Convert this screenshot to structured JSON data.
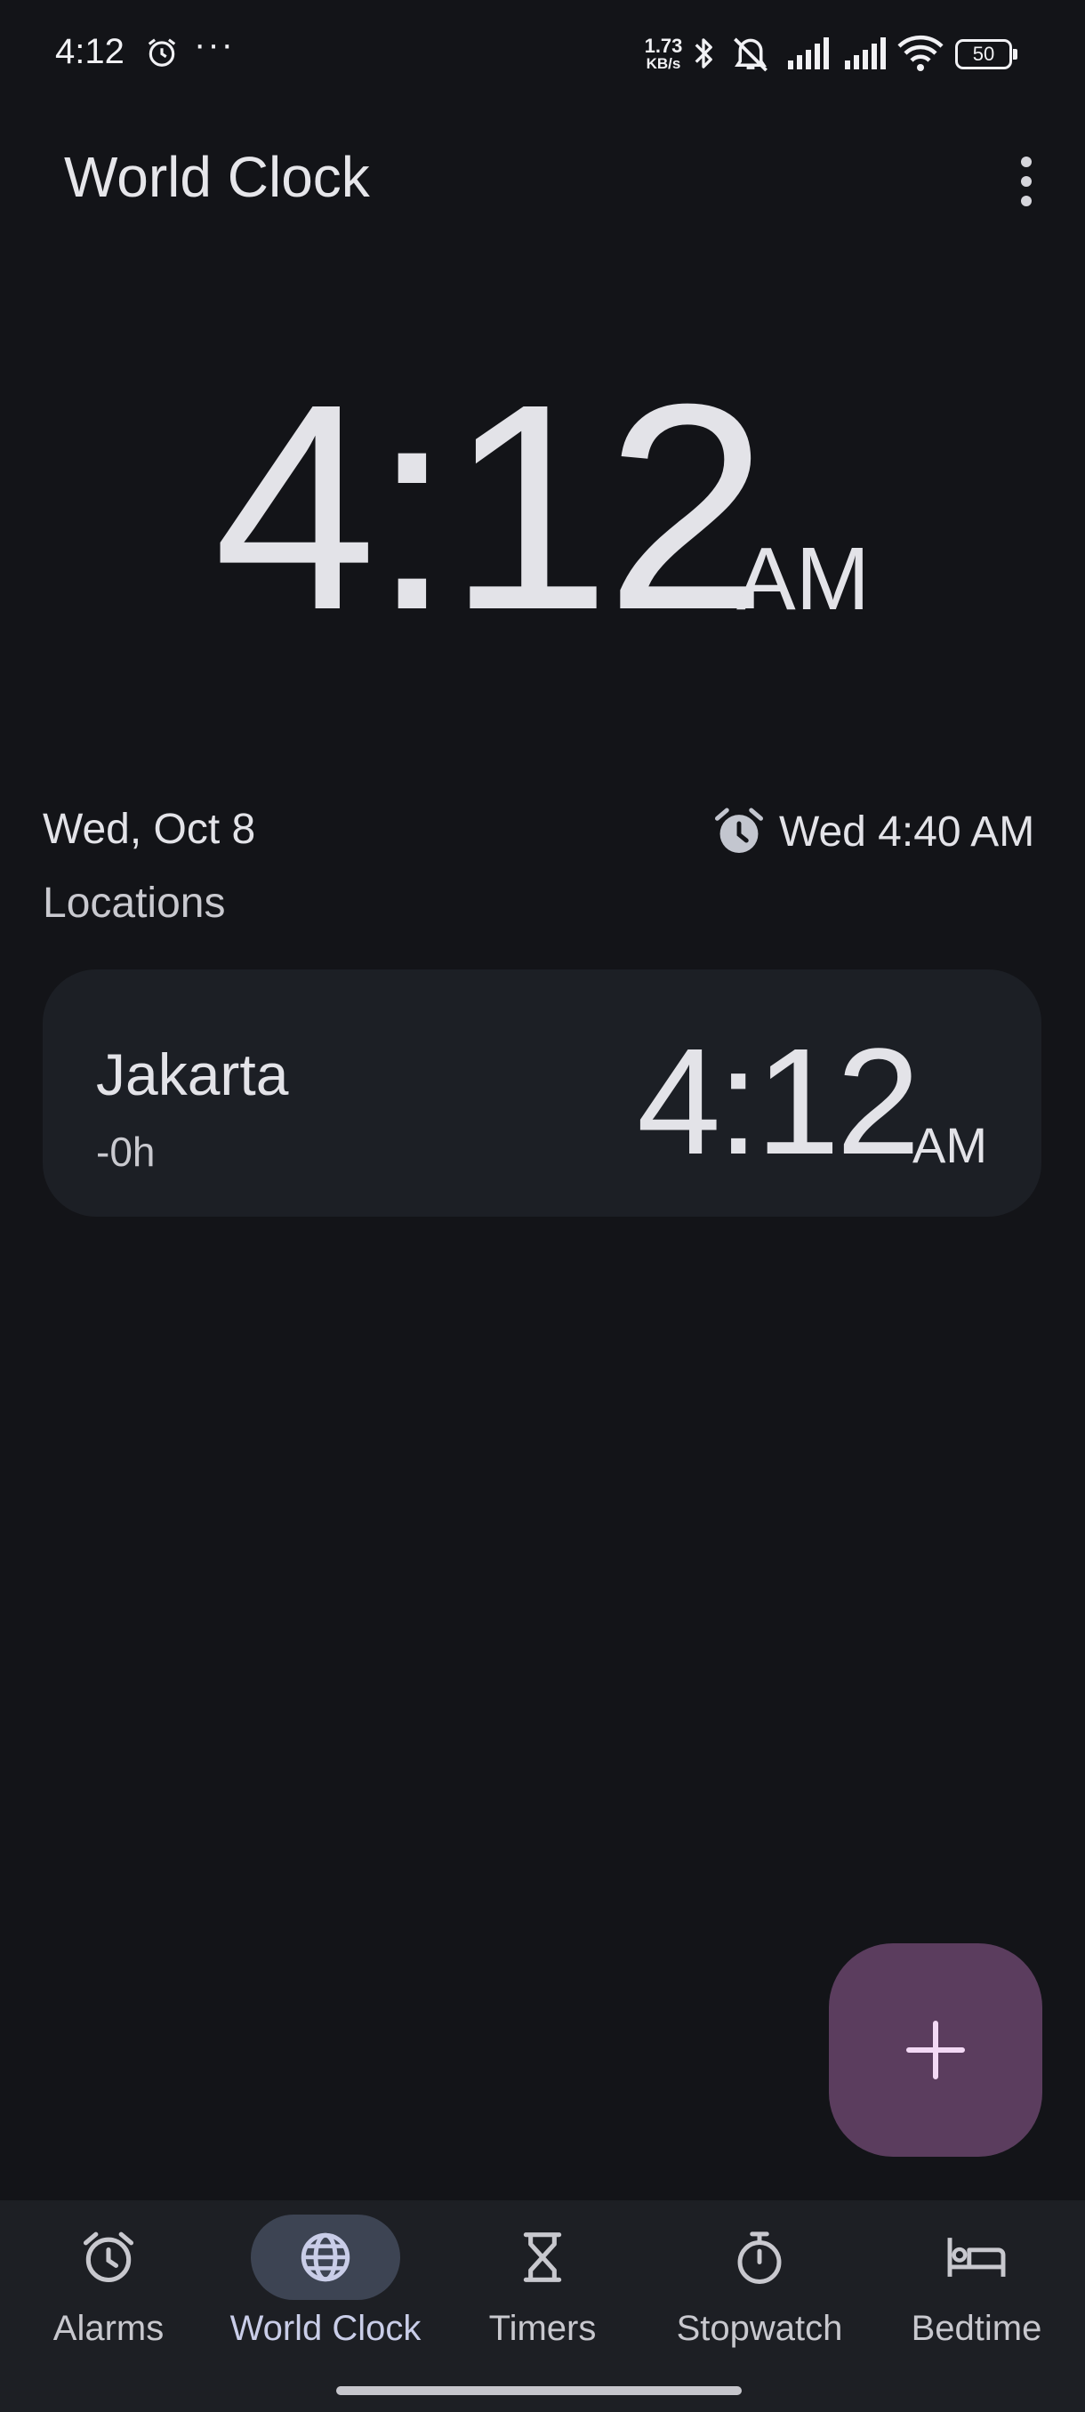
{
  "status_bar": {
    "time": "4:12",
    "more": "···",
    "net_speed_value": "1.73",
    "net_speed_unit": "KB/s",
    "battery": "50",
    "icons": [
      "alarm-icon",
      "bluetooth-icon",
      "mute-icon",
      "signal-icon",
      "signal-icon",
      "wifi-icon",
      "battery-icon"
    ]
  },
  "header": {
    "title": "World Clock",
    "overflow_icon": "more-vert-icon"
  },
  "clock": {
    "time": "4:12",
    "ampm": "AM",
    "date": "Wed, Oct 8",
    "next_alarm": "Wed 4:40 AM"
  },
  "locations": {
    "label": "Locations",
    "items": [
      {
        "city": "Jakarta",
        "offset": "-0h",
        "time": "4:12",
        "ampm": "AM"
      }
    ]
  },
  "fab": {
    "icon": "plus-icon"
  },
  "nav": {
    "items": [
      {
        "label": "Alarms",
        "icon": "alarm-icon",
        "active": false
      },
      {
        "label": "World Clock",
        "icon": "globe-icon",
        "active": true
      },
      {
        "label": "Timers",
        "icon": "hourglass-icon",
        "active": false
      },
      {
        "label": "Stopwatch",
        "icon": "stopwatch-icon",
        "active": false
      },
      {
        "label": "Bedtime",
        "icon": "bed-icon",
        "active": false
      }
    ]
  },
  "colors": {
    "background": "#131418",
    "card": "#1c1f25",
    "fab": "#5b3d5e",
    "fab_icon": "#f3d9f5",
    "nav_bg": "#1d1f24",
    "nav_active": "#3d4453"
  }
}
